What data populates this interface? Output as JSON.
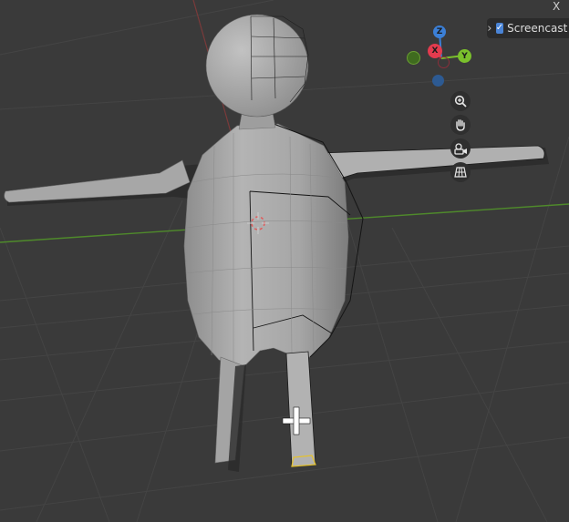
{
  "viewport": {
    "mode": "3D Viewport",
    "object": "humanoid low-poly mesh"
  },
  "overlay_panel": {
    "label": "Screencast K",
    "checked": true,
    "expand_icon": "chevron-right-icon"
  },
  "corner_glyph": "X",
  "gizmo": {
    "z_label": "Z",
    "x_label": "X",
    "y_label": "Y",
    "colors": {
      "z": "#3b7fd6",
      "x": "#e33b4e",
      "y": "#7ac02c",
      "neg_y": "#5c8f2b",
      "neg_z": "#2d5a92",
      "neg_x": "#8a2f3a"
    }
  },
  "nav_buttons": [
    {
      "name": "zoom-button",
      "icon": "magnifier-plus-icon"
    },
    {
      "name": "pan-button",
      "icon": "hand-icon"
    },
    {
      "name": "camera-view-button",
      "icon": "camera-icon"
    },
    {
      "name": "perspective-toggle-button",
      "icon": "grid-icon"
    }
  ],
  "colors": {
    "background": "#3a3a3a",
    "mesh": "#9a9a9a",
    "x_axis_line": "#4f8a2b",
    "y_axis_line": "#7a3a3a"
  }
}
